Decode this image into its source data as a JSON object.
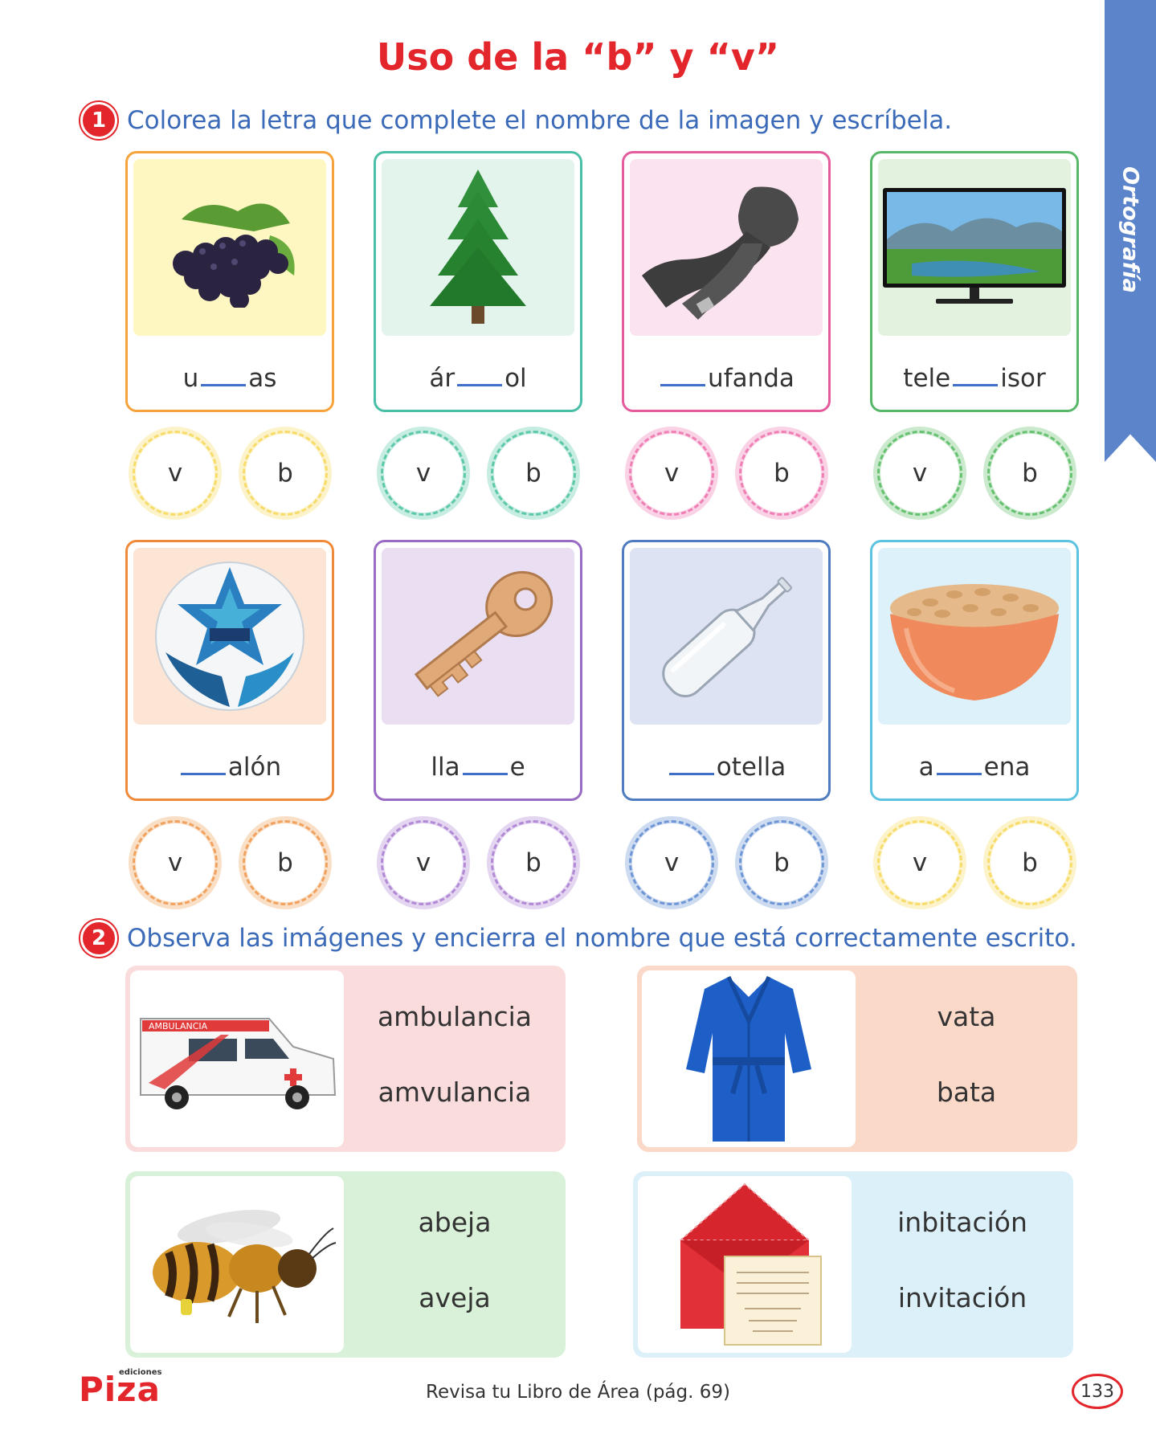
{
  "title": "Uso de la “b” y “v”",
  "side_tab": "Ortografía",
  "activity1": {
    "number": "1",
    "instruction": "Colorea la letra que complete el nombre de la imagen y escríbela.",
    "cards": [
      {
        "before": "u",
        "after": "as",
        "icon": "grapes-icon",
        "color": "#f5a33a",
        "bg": "#fff7c2",
        "option_a": "v",
        "option_b": "b",
        "circle_color": "#f7dc6a"
      },
      {
        "before": "ár",
        "after": "ol",
        "icon": "tree-icon",
        "color": "#48bfa6",
        "bg": "#e3f4ec",
        "option_a": "v",
        "option_b": "b",
        "circle_color": "#5ec9aa"
      },
      {
        "before": "",
        "after": "ufanda",
        "icon": "scarf-icon",
        "color": "#e45b9e",
        "bg": "#fbe3ef",
        "option_a": "v",
        "option_b": "b",
        "circle_color": "#ef7fb5"
      },
      {
        "before": "tele",
        "after": "isor",
        "icon": "tv-icon",
        "color": "#58b86a",
        "bg": "#e2f2df",
        "option_a": "v",
        "option_b": "b",
        "circle_color": "#66c170"
      },
      {
        "before": "",
        "after": "alón",
        "icon": "ball-icon",
        "color": "#ee8a3a",
        "bg": "#fde5d6",
        "option_a": "v",
        "option_b": "b",
        "circle_color": "#f1a25e"
      },
      {
        "before": "lla",
        "after": "e",
        "icon": "key-icon",
        "color": "#9a6bc4",
        "bg": "#e9def2",
        "option_a": "v",
        "option_b": "b",
        "circle_color": "#b38ad6"
      },
      {
        "before": "",
        "after": "otella",
        "icon": "bottle-icon",
        "color": "#4f7cc0",
        "bg": "#dde3f3",
        "option_a": "v",
        "option_b": "b",
        "circle_color": "#6f97d6"
      },
      {
        "before": "a",
        "after": "ena",
        "icon": "oats-bowl-icon",
        "color": "#5cc3e0",
        "bg": "#dcf1f9",
        "option_a": "v",
        "option_b": "b",
        "circle_color": "#f7dc6a"
      }
    ]
  },
  "activity2": {
    "number": "2",
    "instruction": "Observa las imágenes y encierra el nombre que está correctamente escrito.",
    "panels": [
      {
        "option_a": "ambulancia",
        "option_b": "amvulancia",
        "icon": "ambulance-icon",
        "label": "AMBULANCIA",
        "bg": "#fbdcdc"
      },
      {
        "option_a": "vata",
        "option_b": "bata",
        "icon": "bathrobe-icon",
        "bg": "#fbd9c9"
      },
      {
        "option_a": "abeja",
        "option_b": "aveja",
        "icon": "bee-icon",
        "bg": "#d9f1d8"
      },
      {
        "option_a": "inbitación",
        "option_b": "invitación",
        "icon": "invitation-icon",
        "bg": "#dcf0f9"
      }
    ]
  },
  "footer": {
    "logo": "Piza",
    "logo_small": "ediciones",
    "text": "Revisa tu Libro de Área (pág. 69)",
    "page_number": "133"
  }
}
